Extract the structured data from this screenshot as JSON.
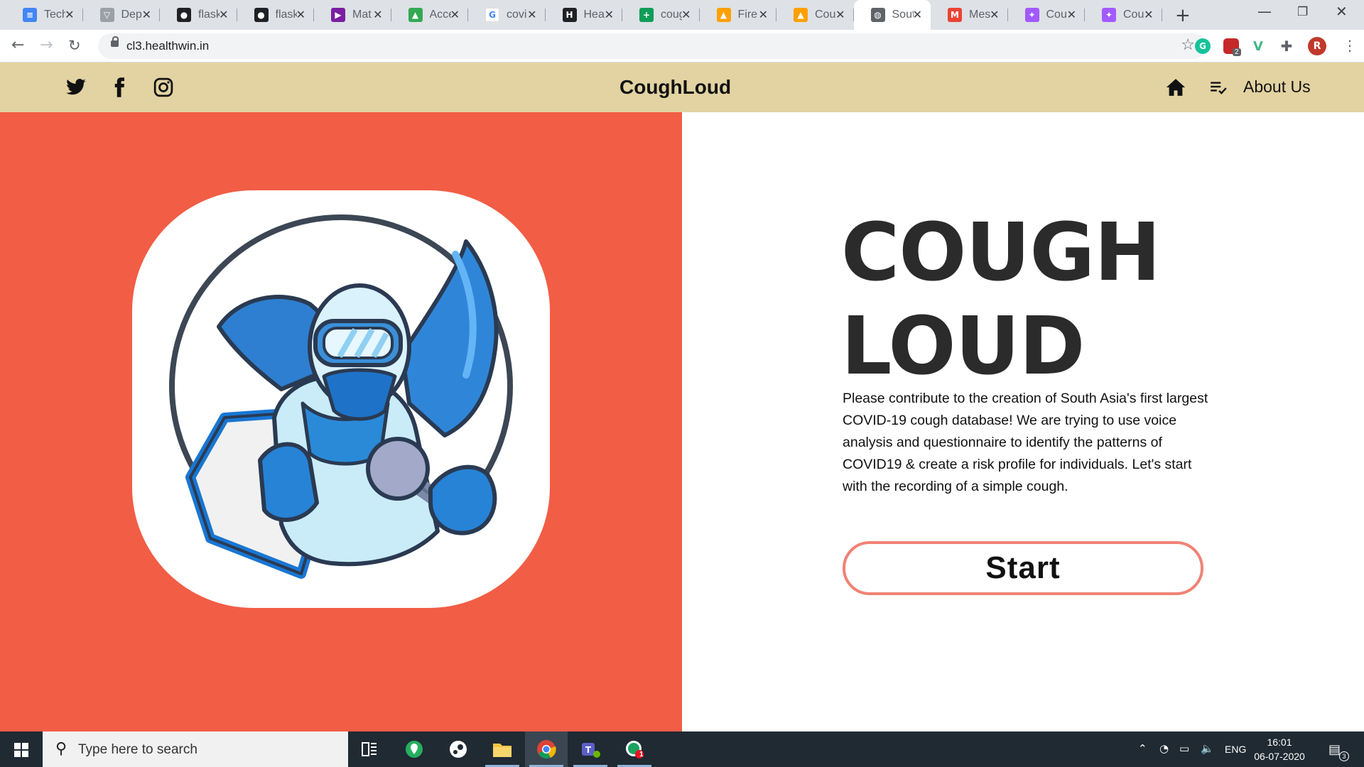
{
  "browser": {
    "tabs": [
      {
        "title": "Tech",
        "icon": "docs-icon",
        "color": "#4285f4",
        "glyph": "≡"
      },
      {
        "title": "Dep",
        "icon": "vue-logo-icon",
        "color": "#9aa0a6",
        "glyph": "▽"
      },
      {
        "title": "flask",
        "icon": "github-icon",
        "color": "#202124",
        "glyph": "●"
      },
      {
        "title": "flask",
        "icon": "github-icon",
        "color": "#202124",
        "glyph": "●"
      },
      {
        "title": "Mat",
        "icon": "play-icon",
        "color": "#7b1fa2",
        "glyph": "▶"
      },
      {
        "title": "Acce",
        "icon": "drive-icon",
        "color": "#34a853",
        "glyph": "▲"
      },
      {
        "title": "covi",
        "icon": "google-icon",
        "color": "#ffffff",
        "glyph": "G"
      },
      {
        "title": "Heal",
        "icon": "app-icon",
        "color": "#202124",
        "glyph": "H"
      },
      {
        "title": "coug",
        "icon": "sheets-icon",
        "color": "#0f9d58",
        "glyph": "+"
      },
      {
        "title": "Fire",
        "icon": "firebase-icon",
        "color": "#ffa000",
        "glyph": "▲"
      },
      {
        "title": "Cou",
        "icon": "firebase-icon",
        "color": "#ffa000",
        "glyph": "▲"
      },
      {
        "title": "Sout",
        "icon": "globe-icon",
        "color": "#5f6368",
        "glyph": "◍"
      },
      {
        "title": "Mes",
        "icon": "gmail-icon",
        "color": "#ea4335",
        "glyph": "M"
      },
      {
        "title": "Cou",
        "icon": "figma-icon",
        "color": "#a259ff",
        "glyph": "✦"
      },
      {
        "title": "Cou",
        "icon": "figma-icon",
        "color": "#a259ff",
        "glyph": "✦"
      }
    ],
    "active_tab_index": 11,
    "url": "cl3.healthwin.in",
    "profile_initial": "R",
    "extension_badge": "2"
  },
  "site": {
    "brand": "CoughLoud",
    "nav": {
      "about": "About Us"
    },
    "hero": {
      "title_line1": "COUGH",
      "title_line2": "LOUD",
      "description": "Please contribute to the creation of South Asia's first largest COVID-19 cough database! We are trying to use voice analysis and questionnaire to identify the patterns of COVID19 & create a risk profile for individuals. Let's start with the recording of a simple cough.",
      "start_label": "Start"
    },
    "colors": {
      "header_bg": "#e3d3a2",
      "left_panel_bg": "#f25d45",
      "button_border": "#f08275"
    }
  },
  "taskbar": {
    "search_placeholder": "Type here to search",
    "language": "ENG",
    "time": "16:01",
    "date": "06-07-2020",
    "notification_count": "3",
    "teams_badge": "1"
  }
}
